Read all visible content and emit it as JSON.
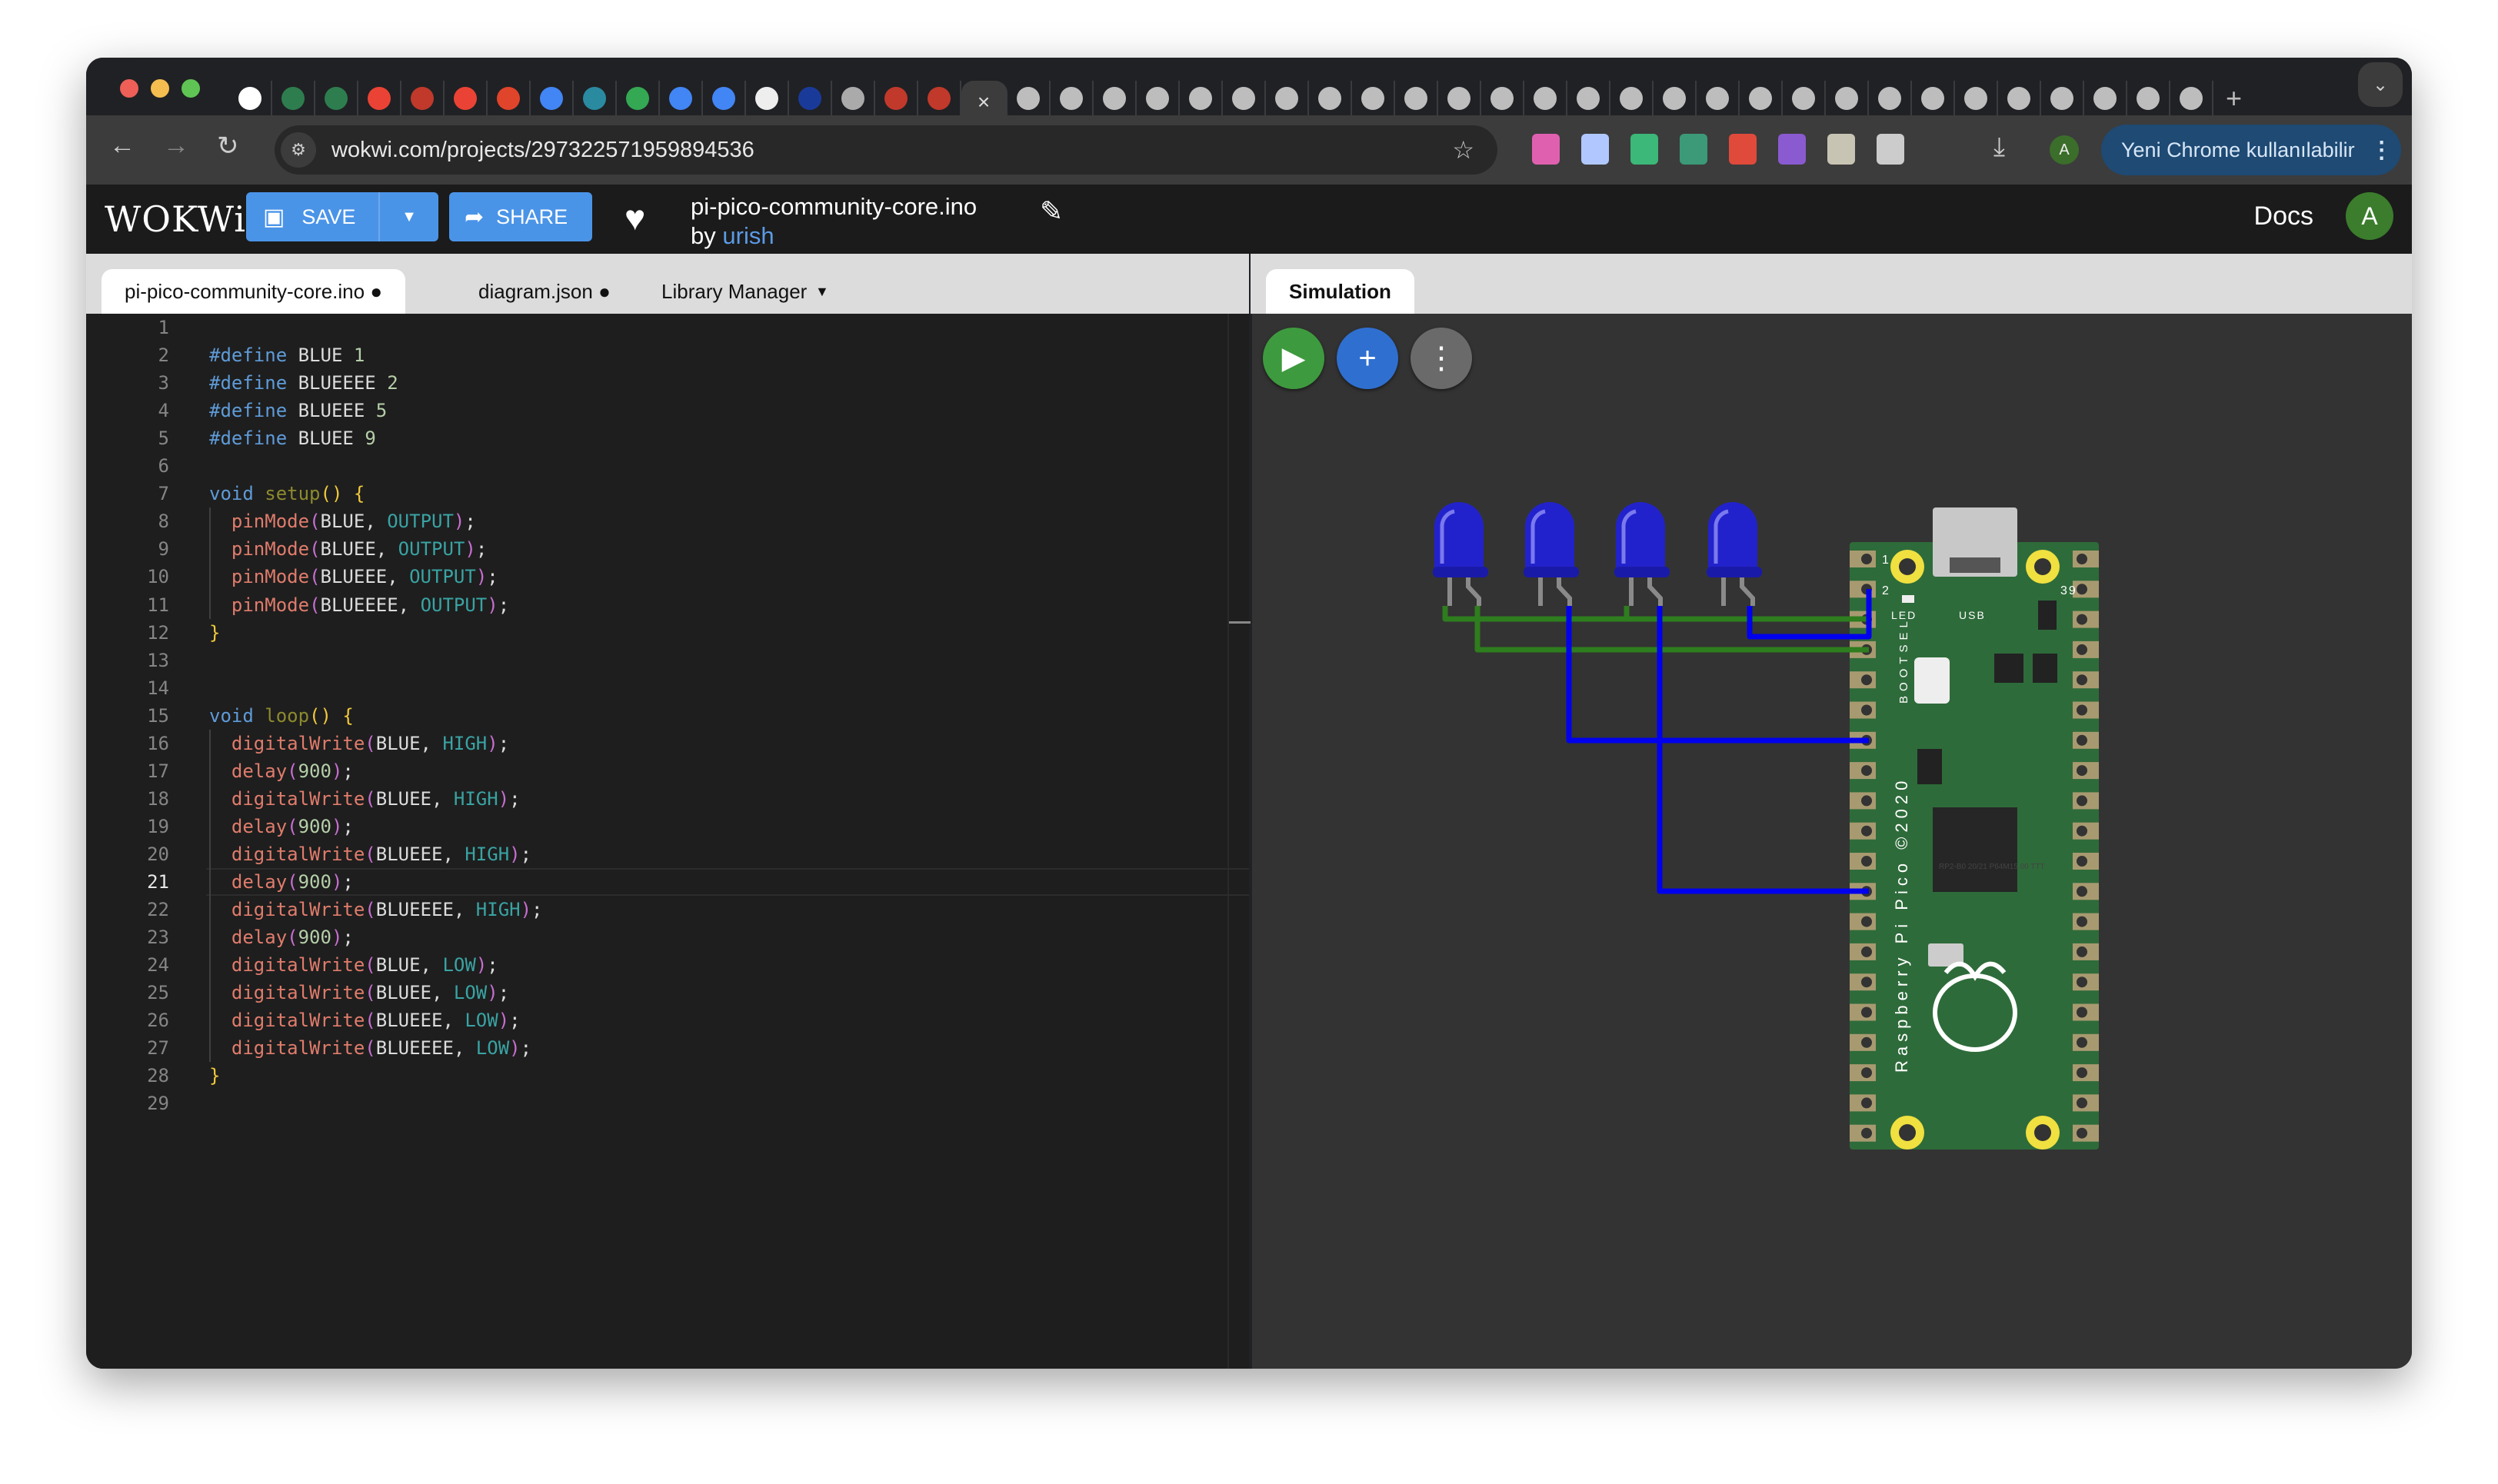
{
  "browser": {
    "tab_icons": [
      "openai-icon",
      "cloud-icon",
      "cloud-icon",
      "gmail-icon",
      "fossasia-icon",
      "gmail-icon",
      "lab-icon",
      "google-icon",
      "space-icon",
      "drive-icon",
      "calendar-icon",
      "google-icon",
      "notes-icon",
      "kicad-icon",
      "chrome-icon",
      "fossasia-icon",
      "fossasia-icon"
    ],
    "tab_icons_right": [
      "wokwi-icon",
      "wokwi-icon",
      "book-icon",
      "globe-icon",
      "globe-icon",
      "google-icon",
      "react-icon",
      "reader-icon",
      "fossasia-icon",
      "fossasia-icon",
      "reader-icon",
      "google-icon",
      "globe-icon",
      "fossasia-icon",
      "youtube-icon",
      "flag-icon",
      "chrome-icon",
      "chart-icon",
      "wokwi-icon",
      "wokwi-icon",
      "globe-icon",
      "gmail-icon",
      "lab-icon",
      "lab-icon",
      "wokwi-icon",
      "netflix-icon",
      "openai-icon",
      "chrome-icon"
    ],
    "tab_icon_colors": [
      "#ffffff",
      "#2e7d4f",
      "#2e7d4f",
      "#ea4335",
      "#c0392b",
      "#ea4335",
      "#e0442b",
      "#4285f4",
      "#2a8aa0",
      "#34a853",
      "#4285f4",
      "#4285f4",
      "#eeeeee",
      "#1a3a9a",
      "#aaaaaa",
      "#c0392b",
      "#c0392b"
    ],
    "active_tab_close": "×",
    "new_tab": "+",
    "tab_search": "⌄",
    "url": "wokwi.com/projects/297322571959894536",
    "update_label": "Yeni Chrome kullanılabilir",
    "profile_initial": "A",
    "extension_colors": [
      "#e060b0",
      "#b0c8ff",
      "#3cb878",
      "#3c9a78",
      "#e04a3a",
      "#8a5ad0",
      "#c8c4b4",
      "#cccccc"
    ]
  },
  "header": {
    "logo": "WOKWi",
    "save_label": "SAVE",
    "share_label": "SHARE",
    "project_name": "pi-pico-community-core.ino",
    "by": "by",
    "author": "urish",
    "docs": "Docs",
    "avatar": "A"
  },
  "editor": {
    "tabs": [
      {
        "label": "pi-pico-community-core.ino ●"
      },
      {
        "label": "diagram.json ●"
      },
      {
        "label": "Library Manager"
      }
    ],
    "current_line": 21,
    "lines": [
      [],
      [
        [
          "kw",
          "#define"
        ],
        [
          "id",
          " BLUE "
        ],
        [
          "nu",
          "1"
        ]
      ],
      [
        [
          "kw",
          "#define"
        ],
        [
          "id",
          " BLUEEEE "
        ],
        [
          "nu",
          "2"
        ]
      ],
      [
        [
          "kw",
          "#define"
        ],
        [
          "id",
          " BLUEEE "
        ],
        [
          "nu",
          "5"
        ]
      ],
      [
        [
          "kw",
          "#define"
        ],
        [
          "id",
          " BLUEE "
        ],
        [
          "nu",
          "9"
        ]
      ],
      [],
      [
        [
          "kw",
          "void "
        ],
        [
          "fn",
          "setup"
        ],
        [
          "br",
          "() {"
        ]
      ],
      [
        [
          "id",
          "  "
        ],
        [
          "cl",
          "pinMode"
        ],
        [
          "pa",
          "("
        ],
        [
          "id",
          "BLUE, "
        ],
        [
          "cs",
          "OUTPUT"
        ],
        [
          "pa",
          ")"
        ],
        [
          "id",
          ";"
        ]
      ],
      [
        [
          "id",
          "  "
        ],
        [
          "cl",
          "pinMode"
        ],
        [
          "pa",
          "("
        ],
        [
          "id",
          "BLUEE, "
        ],
        [
          "cs",
          "OUTPUT"
        ],
        [
          "pa",
          ")"
        ],
        [
          "id",
          ";"
        ]
      ],
      [
        [
          "id",
          "  "
        ],
        [
          "cl",
          "pinMode"
        ],
        [
          "pa",
          "("
        ],
        [
          "id",
          "BLUEEE, "
        ],
        [
          "cs",
          "OUTPUT"
        ],
        [
          "pa",
          ")"
        ],
        [
          "id",
          ";"
        ]
      ],
      [
        [
          "id",
          "  "
        ],
        [
          "cl",
          "pinMode"
        ],
        [
          "pa",
          "("
        ],
        [
          "id",
          "BLUEEEE, "
        ],
        [
          "cs",
          "OUTPUT"
        ],
        [
          "pa",
          ")"
        ],
        [
          "id",
          ";"
        ]
      ],
      [
        [
          "br",
          "}"
        ]
      ],
      [],
      [],
      [
        [
          "kw",
          "void "
        ],
        [
          "fn",
          "loop"
        ],
        [
          "br",
          "() {"
        ]
      ],
      [
        [
          "id",
          "  "
        ],
        [
          "cl",
          "digitalWrite"
        ],
        [
          "pa",
          "("
        ],
        [
          "id",
          "BLUE, "
        ],
        [
          "cs",
          "HIGH"
        ],
        [
          "pa",
          ")"
        ],
        [
          "id",
          ";"
        ]
      ],
      [
        [
          "id",
          "  "
        ],
        [
          "cl",
          "delay"
        ],
        [
          "pa",
          "("
        ],
        [
          "nu",
          "900"
        ],
        [
          "pa",
          ")"
        ],
        [
          "id",
          ";"
        ]
      ],
      [
        [
          "id",
          "  "
        ],
        [
          "cl",
          "digitalWrite"
        ],
        [
          "pa",
          "("
        ],
        [
          "id",
          "BLUEE, "
        ],
        [
          "cs",
          "HIGH"
        ],
        [
          "pa",
          ")"
        ],
        [
          "id",
          ";"
        ]
      ],
      [
        [
          "id",
          "  "
        ],
        [
          "cl",
          "delay"
        ],
        [
          "pa",
          "("
        ],
        [
          "nu",
          "900"
        ],
        [
          "pa",
          ")"
        ],
        [
          "id",
          ";"
        ]
      ],
      [
        [
          "id",
          "  "
        ],
        [
          "cl",
          "digitalWrite"
        ],
        [
          "pa",
          "("
        ],
        [
          "id",
          "BLUEEE, "
        ],
        [
          "cs",
          "HIGH"
        ],
        [
          "pa",
          ")"
        ],
        [
          "id",
          ";"
        ]
      ],
      [
        [
          "id",
          "  "
        ],
        [
          "cl",
          "delay"
        ],
        [
          "pa",
          "("
        ],
        [
          "nu",
          "900"
        ],
        [
          "pa",
          ")"
        ],
        [
          "id",
          ";"
        ]
      ],
      [
        [
          "id",
          "  "
        ],
        [
          "cl",
          "digitalWrite"
        ],
        [
          "pa",
          "("
        ],
        [
          "id",
          "BLUEEEE, "
        ],
        [
          "cs",
          "HIGH"
        ],
        [
          "pa",
          ")"
        ],
        [
          "id",
          ";"
        ]
      ],
      [
        [
          "id",
          "  "
        ],
        [
          "cl",
          "delay"
        ],
        [
          "pa",
          "("
        ],
        [
          "nu",
          "900"
        ],
        [
          "pa",
          ")"
        ],
        [
          "id",
          ";"
        ]
      ],
      [
        [
          "id",
          "  "
        ],
        [
          "cl",
          "digitalWrite"
        ],
        [
          "pa",
          "("
        ],
        [
          "id",
          "BLUE, "
        ],
        [
          "cs",
          "LOW"
        ],
        [
          "pa",
          ")"
        ],
        [
          "id",
          ";"
        ]
      ],
      [
        [
          "id",
          "  "
        ],
        [
          "cl",
          "digitalWrite"
        ],
        [
          "pa",
          "("
        ],
        [
          "id",
          "BLUEE, "
        ],
        [
          "cs",
          "LOW"
        ],
        [
          "pa",
          ")"
        ],
        [
          "id",
          ";"
        ]
      ],
      [
        [
          "id",
          "  "
        ],
        [
          "cl",
          "digitalWrite"
        ],
        [
          "pa",
          "("
        ],
        [
          "id",
          "BLUEEE, "
        ],
        [
          "cs",
          "LOW"
        ],
        [
          "pa",
          ")"
        ],
        [
          "id",
          ";"
        ]
      ],
      [
        [
          "id",
          "  "
        ],
        [
          "cl",
          "digitalWrite"
        ],
        [
          "pa",
          "("
        ],
        [
          "id",
          "BLUEEEE, "
        ],
        [
          "cs",
          "LOW"
        ],
        [
          "pa",
          ")"
        ],
        [
          "id",
          ";"
        ]
      ],
      [
        [
          "br",
          "}"
        ]
      ],
      []
    ]
  },
  "simulation": {
    "tab_label": "Simulation",
    "board": {
      "pin1": "1",
      "pin2": "2",
      "pin39": "39",
      "led": "LED",
      "usb": "USB",
      "bootsel": "BOOTSEL",
      "name": "Raspberry Pi Pico ©2020",
      "chip": "RP2-B0 20/21 P64M15.00 TTT"
    },
    "led_color": "#2222cc",
    "led_count": 4,
    "wire_colors": {
      "gnd": "#2e7d1e",
      "signal": "#0000ee"
    },
    "board_color": "#2e6b3a"
  }
}
